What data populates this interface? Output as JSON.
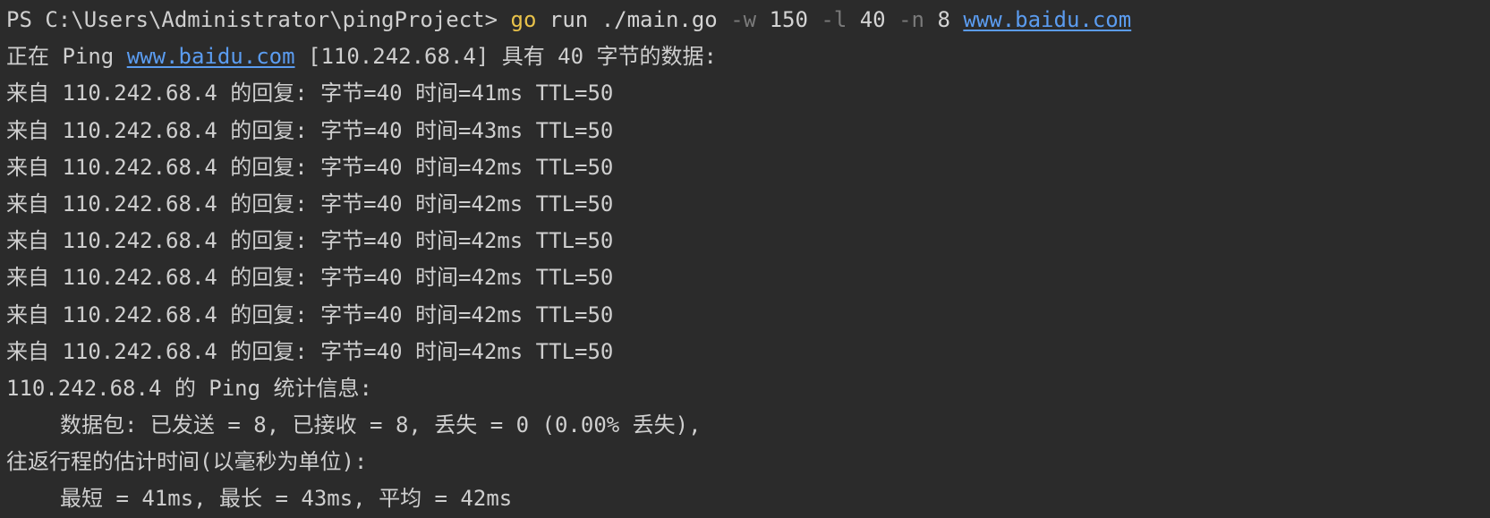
{
  "terminal": {
    "prompt": "PS C:\\Users\\Administrator\\pingProject> ",
    "command": {
      "program": "go",
      "sub": "run",
      "file": "./main.go",
      "flag_w": "-w",
      "value_w": "150",
      "flag_l": "-l",
      "value_l": "40",
      "flag_n": "-n",
      "value_n": "8",
      "host": "www.baidu.com"
    },
    "header": {
      "prefix": "正在 Ping ",
      "host": "www.baidu.com",
      "suffix": " [110.242.68.4] 具有 40 字节的数据:"
    },
    "replies": [
      "来自 110.242.68.4 的回复: 字节=40 时间=41ms TTL=50",
      "来自 110.242.68.4 的回复: 字节=40 时间=43ms TTL=50",
      "来自 110.242.68.4 的回复: 字节=40 时间=42ms TTL=50",
      "来自 110.242.68.4 的回复: 字节=40 时间=42ms TTL=50",
      "来自 110.242.68.4 的回复: 字节=40 时间=42ms TTL=50",
      "来自 110.242.68.4 的回复: 字节=40 时间=42ms TTL=50",
      "来自 110.242.68.4 的回复: 字节=40 时间=42ms TTL=50",
      "来自 110.242.68.4 的回复: 字节=40 时间=42ms TTL=50"
    ],
    "stats_title": "110.242.68.4 的 Ping 统计信息:",
    "packets": "数据包: 已发送 = 8, 已接收 = 8, 丢失 = 0 (0.00% 丢失),",
    "rtt_title": "往返行程的估计时间(以毫秒为单位):",
    "rtt_values": "最短 = 41ms, 最长 = 43ms, 平均 = 42ms"
  },
  "colors": {
    "background": "#2b2b2b",
    "text": "#cfcfcf",
    "command": "#e8c24a",
    "flag": "#7a7a7a",
    "link": "#5b9cf0"
  }
}
